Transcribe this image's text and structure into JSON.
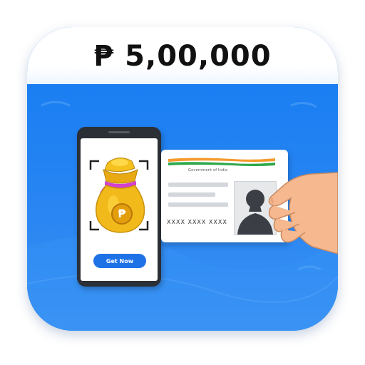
{
  "header": {
    "amount_text": "₱ 5,00,000"
  },
  "phone": {
    "button_label": "Get Now",
    "bag_symbol": "₱"
  },
  "id_card": {
    "issuer_text": "Government of India",
    "number_text": "XXXX XXXX XXXX",
    "flag_colors": [
      "#f59a2c",
      "#ffffff",
      "#2fa84a"
    ]
  },
  "colors": {
    "background_blue": "#1e7df0",
    "button_blue": "#1f72e6",
    "bag_gold": "#f2b91a",
    "ribbon_pink": "#d43fd1",
    "skin": "#f6b98f"
  },
  "icons": [
    "money-bag-icon",
    "peso-coin-icon",
    "person-silhouette-icon",
    "hand-icon",
    "scan-frame-icon"
  ]
}
